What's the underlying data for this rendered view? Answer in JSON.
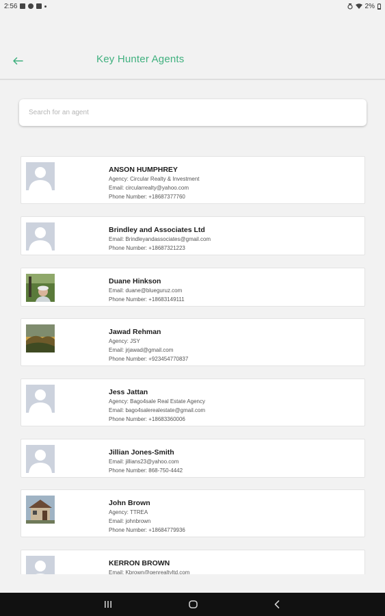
{
  "status": {
    "time": "2:56",
    "battery": "2%"
  },
  "header": {
    "title": "Key Hunter Agents"
  },
  "search": {
    "placeholder": "Search for an agent"
  },
  "agents": [
    {
      "name": "ANSON HUMPHREY",
      "lines": [
        "Agency: Circular Realty & Investment",
        "Email: circularrealty@yahoo.com",
        "Phone Number: +18687377760"
      ],
      "avatar": "placeholder"
    },
    {
      "name": "Brindley and  Associates Ltd",
      "lines": [
        "Email: Brindleyandassociates@gmail.com",
        "Phone Number: +18687321223"
      ],
      "avatar": "placeholder"
    },
    {
      "name": "Duane Hinkson",
      "lines": [
        "Email: duane@blueguruz.com",
        "Phone Number: +18683149111"
      ],
      "avatar": "photo-person"
    },
    {
      "name": "Jawad Rehman",
      "lines": [
        "Agency: JSY",
        "Email: jrjawad@gmail.com",
        "Phone Number: +923454770837"
      ],
      "avatar": "photo-landscape"
    },
    {
      "name": "Jess Jattan",
      "lines": [
        "Agency: Bago4sale Real Estate Agency",
        "Email: bago4salerealestate@gmail.com",
        "Phone Number: +18683360006"
      ],
      "avatar": "placeholder"
    },
    {
      "name": "Jillian Jones-Smith",
      "lines": [
        "Email: jillians23@yahoo.com",
        "Phone Number: 868-750-4442"
      ],
      "avatar": "placeholder"
    },
    {
      "name": "John Brown",
      "lines": [
        "Agency: TTREA",
        "Email: johnbrown",
        "Phone Number: +18684779936"
      ],
      "avatar": "photo-house"
    },
    {
      "name": "KERRON BROWN",
      "lines": [
        "Email: Kbrown@genrealtyltd.com"
      ],
      "avatar": "placeholder"
    }
  ],
  "colors": {
    "accent": "#3fb07e",
    "placeholder_avatar": "#ccd2dd",
    "nav_bar": "#111111"
  },
  "icons": {
    "back": "arrow-left-icon",
    "nav_recent": "recent-apps-icon",
    "nav_home": "home-icon",
    "nav_back": "nav-back-icon"
  }
}
